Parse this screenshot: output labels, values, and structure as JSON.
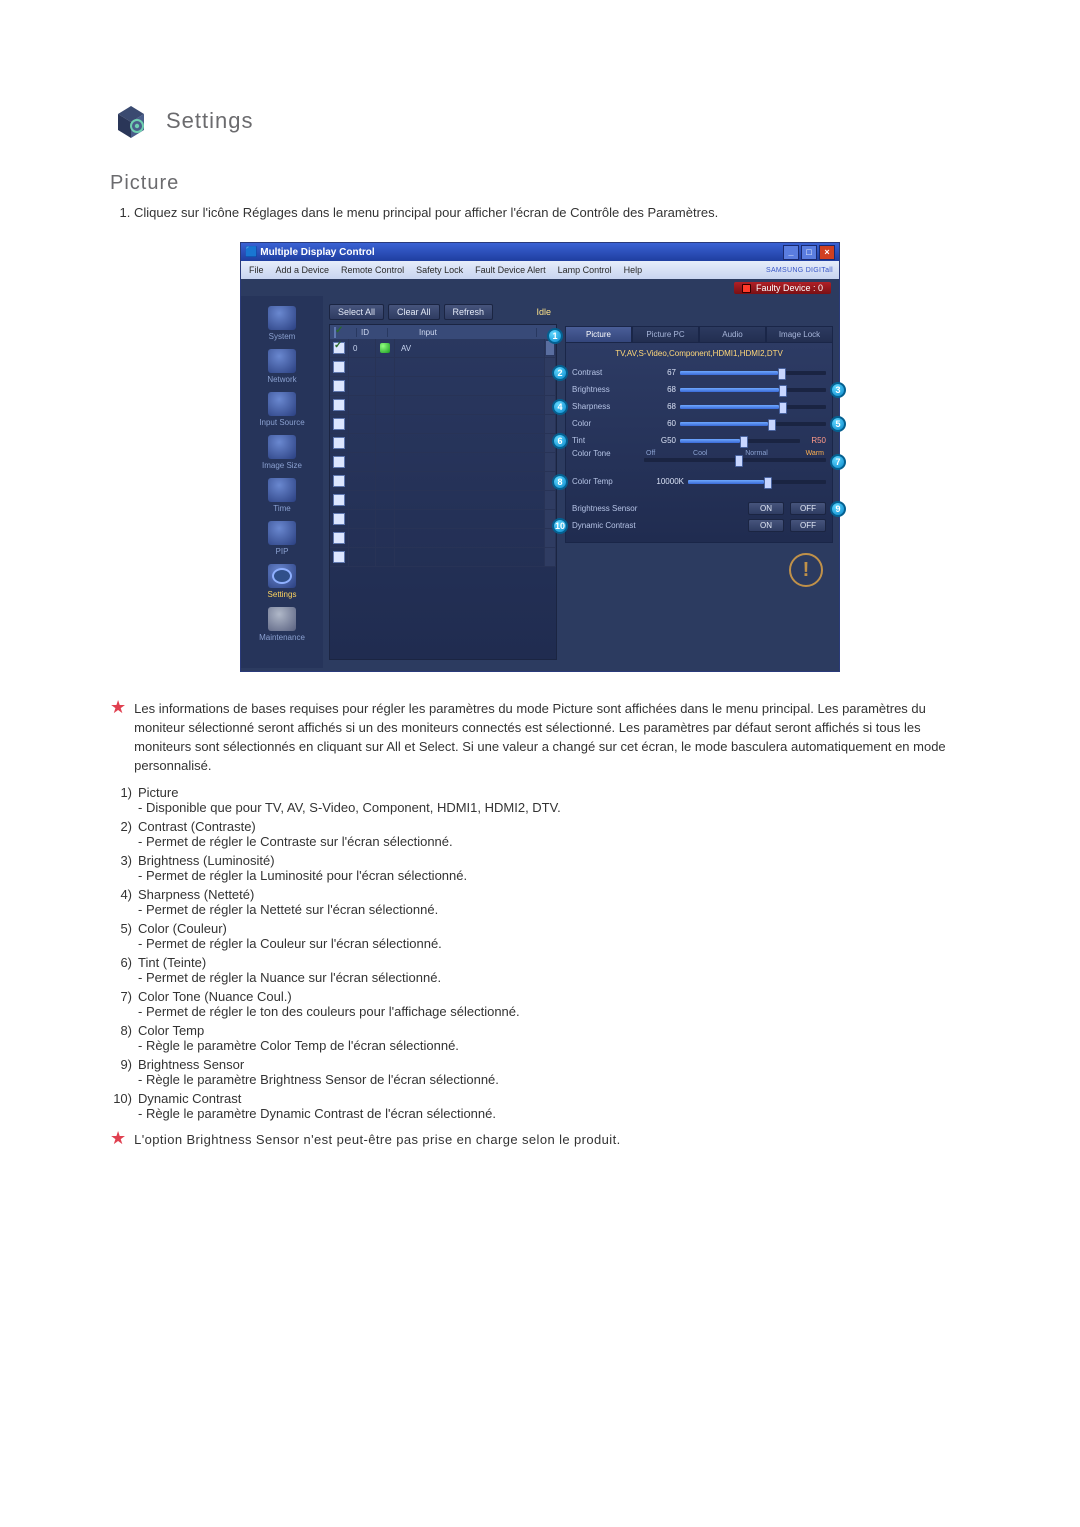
{
  "header": {
    "title": "Settings"
  },
  "section": {
    "title": "Picture"
  },
  "intro_list": [
    "Cliquez sur l'icône Réglages dans le menu principal pour afficher l'écran de Contrôle des Paramètres."
  ],
  "screenshot": {
    "window_title": "Multiple Display Control",
    "menu": [
      "File",
      "Add a Device",
      "Remote Control",
      "Safety Lock",
      "Fault Device Alert",
      "Lamp Control",
      "Help"
    ],
    "brand": "SAMSUNG DIGITall",
    "faulty": "Faulty Device : 0",
    "sidebar": [
      {
        "label": "System"
      },
      {
        "label": "Network"
      },
      {
        "label": "Input Source"
      },
      {
        "label": "Image Size"
      },
      {
        "label": "Time"
      },
      {
        "label": "PIP"
      },
      {
        "label": "Settings",
        "active": true
      },
      {
        "label": "Maintenance"
      }
    ],
    "buttons": {
      "select_all": "Select All",
      "clear_all": "Clear All",
      "refresh": "Refresh",
      "idle": "Idle"
    },
    "grid": {
      "headers": {
        "id": "ID",
        "input": "Input"
      },
      "row0": {
        "id": "0",
        "input": "AV"
      }
    },
    "tabs": {
      "picture": "Picture",
      "picture_pc": "Picture PC",
      "audio": "Audio",
      "image_lock": "Image Lock"
    },
    "source_line": "TV,AV,S-Video,Component,HDMI1,HDMI2,DTV",
    "rows": {
      "contrast": {
        "label": "Contrast",
        "value": "67",
        "pct": 67
      },
      "brightness": {
        "label": "Brightness",
        "value": "68",
        "pct": 68
      },
      "sharpness": {
        "label": "Sharpness",
        "value": "68",
        "pct": 68
      },
      "color": {
        "label": "Color",
        "value": "60",
        "pct": 60
      },
      "tint": {
        "label": "Tint",
        "value": "G50",
        "pct": 50,
        "right": "R50"
      },
      "colortone": {
        "label": "Color Tone",
        "ticks": [
          "Off",
          "Cool",
          "Normal",
          "Warm"
        ],
        "pct": 50
      },
      "colortemp": {
        "label": "Color Temp",
        "value": "10000K",
        "pct": 55
      },
      "bsensor": {
        "label": "Brightness Sensor",
        "on": "ON",
        "off": "OFF"
      },
      "dcontrast": {
        "label": "Dynamic Contrast",
        "on": "ON",
        "off": "OFF"
      }
    },
    "badges": {
      "1": "1",
      "2": "2",
      "3": "3",
      "4": "4",
      "5": "5",
      "6": "6",
      "7": "7",
      "8": "8",
      "9": "9",
      "10": "10"
    }
  },
  "note1": "Les informations de bases requises pour régler les paramètres du mode Picture sont affichées dans le menu principal. Les paramètres du moniteur sélectionné seront affichés si un des moniteurs connectés est sélectionné. Les paramètres par défaut seront affichés si tous les moniteurs sont sélectionnés en cliquant sur All et Select. Si une valeur a changé sur cet écran, le mode basculera automatiquement en mode personnalisé.",
  "items": [
    {
      "n": "1)",
      "t": "Picture",
      "s": "- Disponible que pour TV, AV, S-Video, Component, HDMI1, HDMI2, DTV."
    },
    {
      "n": "2)",
      "t": "Contrast (Contraste)",
      "s": "- Permet de régler le Contraste sur l'écran sélectionné."
    },
    {
      "n": "3)",
      "t": "Brightness (Luminosité)",
      "s": "- Permet de régler la Luminosité pour l'écran sélectionné."
    },
    {
      "n": "4)",
      "t": "Sharpness (Netteté)",
      "s": "- Permet de régler la Netteté sur l'écran sélectionné."
    },
    {
      "n": "5)",
      "t": "Color (Couleur)",
      "s": "- Permet de régler la Couleur sur l'écran sélectionné."
    },
    {
      "n": "6)",
      "t": "Tint (Teinte)",
      "s": "- Permet de régler la Nuance sur l'écran sélectionné."
    },
    {
      "n": "7)",
      "t": "Color Tone (Nuance Coul.)",
      "s": "- Permet de régler le ton des couleurs pour l'affichage sélectionné."
    },
    {
      "n": "8)",
      "t": "Color Temp",
      "s": "- Règle le paramètre Color Temp de l'écran sélectionné."
    },
    {
      "n": "9)",
      "t": "Brightness Sensor",
      "s": "- Règle le paramètre Brightness Sensor de l'écran sélectionné."
    },
    {
      "n": "10)",
      "t": "Dynamic Contrast",
      "s": "- Règle le paramètre Dynamic Contrast de l'écran sélectionné."
    }
  ],
  "note2": "L'option Brightness Sensor n'est peut-être pas prise en charge selon le produit."
}
